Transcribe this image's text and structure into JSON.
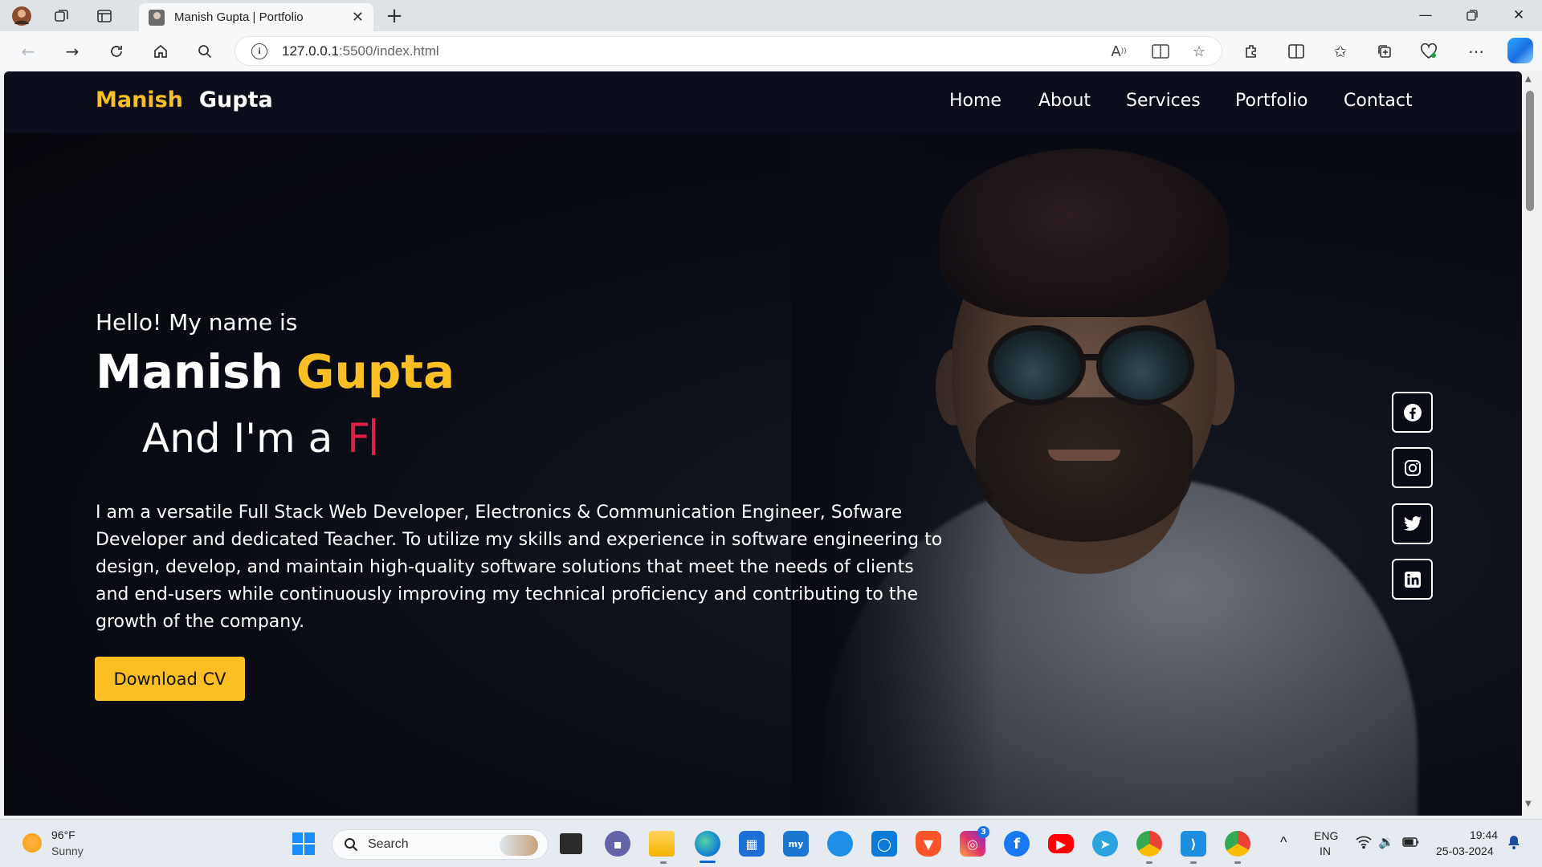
{
  "browser": {
    "tab_title": "Manish Gupta | Portfolio",
    "url_host": "127.0.0.1",
    "url_rest": ":5500/index.html"
  },
  "site": {
    "logo_first": "Manish",
    "logo_last": "Gupta",
    "nav": [
      "Home",
      "About",
      "Services",
      "Portfolio",
      "Contact"
    ]
  },
  "hero": {
    "greeting": "Hello! My name is",
    "name_first": "Manish",
    "name_last": "Gupta",
    "typed_prefix": "And I'm a",
    "typed_text": "F",
    "description": "I am a versatile Full Stack Web Developer, Electronics & Communication Engineer, Sofware Developer and dedicated Teacher. To utilize my skills and experience in software engineering to design, develop, and maintain high-quality software solutions that meet the needs of clients and end-users while continuously improving my technical proficiency and contributing to the growth of the company.",
    "cta": "Download CV"
  },
  "social": [
    "facebook-icon",
    "instagram-icon",
    "twitter-icon",
    "linkedin-icon"
  ],
  "colors": {
    "accent": "#fbbf24",
    "typed": "#e11d48",
    "background": "#080a14"
  },
  "taskbar": {
    "weather_temp": "96°F",
    "weather_cond": "Sunny",
    "search_label": "Search",
    "instagram_badge": "3",
    "lang": "ENG",
    "region": "IN",
    "time": "19:44",
    "date": "25-03-2024"
  }
}
